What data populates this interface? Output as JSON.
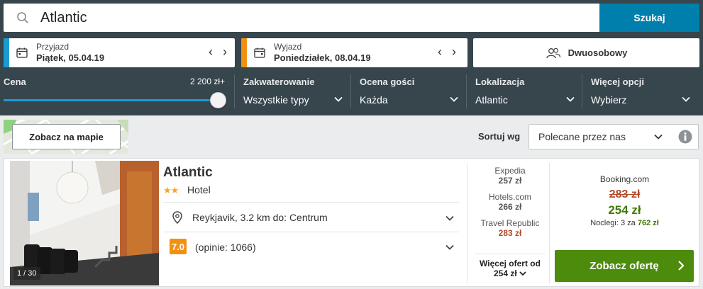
{
  "search": {
    "value": "Atlantic",
    "button_label": "Szukaj"
  },
  "checkin": {
    "label": "Przyjazd",
    "value": "Piątek, 05.04.19",
    "accent_color": "#1a9bd1"
  },
  "checkout": {
    "label": "Wyjazd",
    "value": "Poniedziałek, 08.04.19",
    "accent_color": "#f29111"
  },
  "room": {
    "label": "Dwuosobowy",
    "icon": "users-icon"
  },
  "filters": {
    "price": {
      "label": "Cena",
      "max_value": "2 200 zł+",
      "slider_level_percent": 100
    },
    "accommodation": {
      "label": "Zakwaterowanie",
      "value": "Wszystkie typy"
    },
    "guest_rating": {
      "label": "Ocena gości",
      "value": "Każda"
    },
    "location": {
      "label": "Lokalizacja",
      "value": "Atlantic"
    },
    "more": {
      "label": "Więcej opcji",
      "value": "Wybierz"
    }
  },
  "map": {
    "button_label": "Zobacz na mapie"
  },
  "sort": {
    "label": "Sortuj wg",
    "value": "Polecane przez nas",
    "info_icon": "info-icon"
  },
  "hotel": {
    "name": "Atlantic",
    "stars": 2,
    "stars_glyph": "★★",
    "type": "Hotel",
    "location": "Reykjavik, 3.2 km do: Centrum",
    "rating": "7.0",
    "reviews": "(opinie: 1066)",
    "photo_counter": "1 / 30",
    "offers": [
      {
        "provider": "Expedia",
        "price": "257 zł",
        "highlight": false
      },
      {
        "provider": "Hotels.com",
        "price": "266 zł",
        "highlight": false
      },
      {
        "provider": "Travel Republic",
        "price": "283 zł",
        "highlight": true
      }
    ],
    "more_offers_label": "Więcej ofert od",
    "more_offers_price": "254 zł",
    "best": {
      "provider": "Booking.com",
      "old_price": "283 zł",
      "new_price": "254 zł",
      "nights_prefix": "Noclegi: 3 za ",
      "nights_total": "762 zł"
    },
    "cta_label": "Zobacz ofertę"
  },
  "colors": {
    "header_bg": "#37454d",
    "search_button": "#007fad",
    "cta_green": "#4c8b0b",
    "rating_orange": "#f29111",
    "price_green": "#3d7a00",
    "price_red": "#b14a2a"
  }
}
